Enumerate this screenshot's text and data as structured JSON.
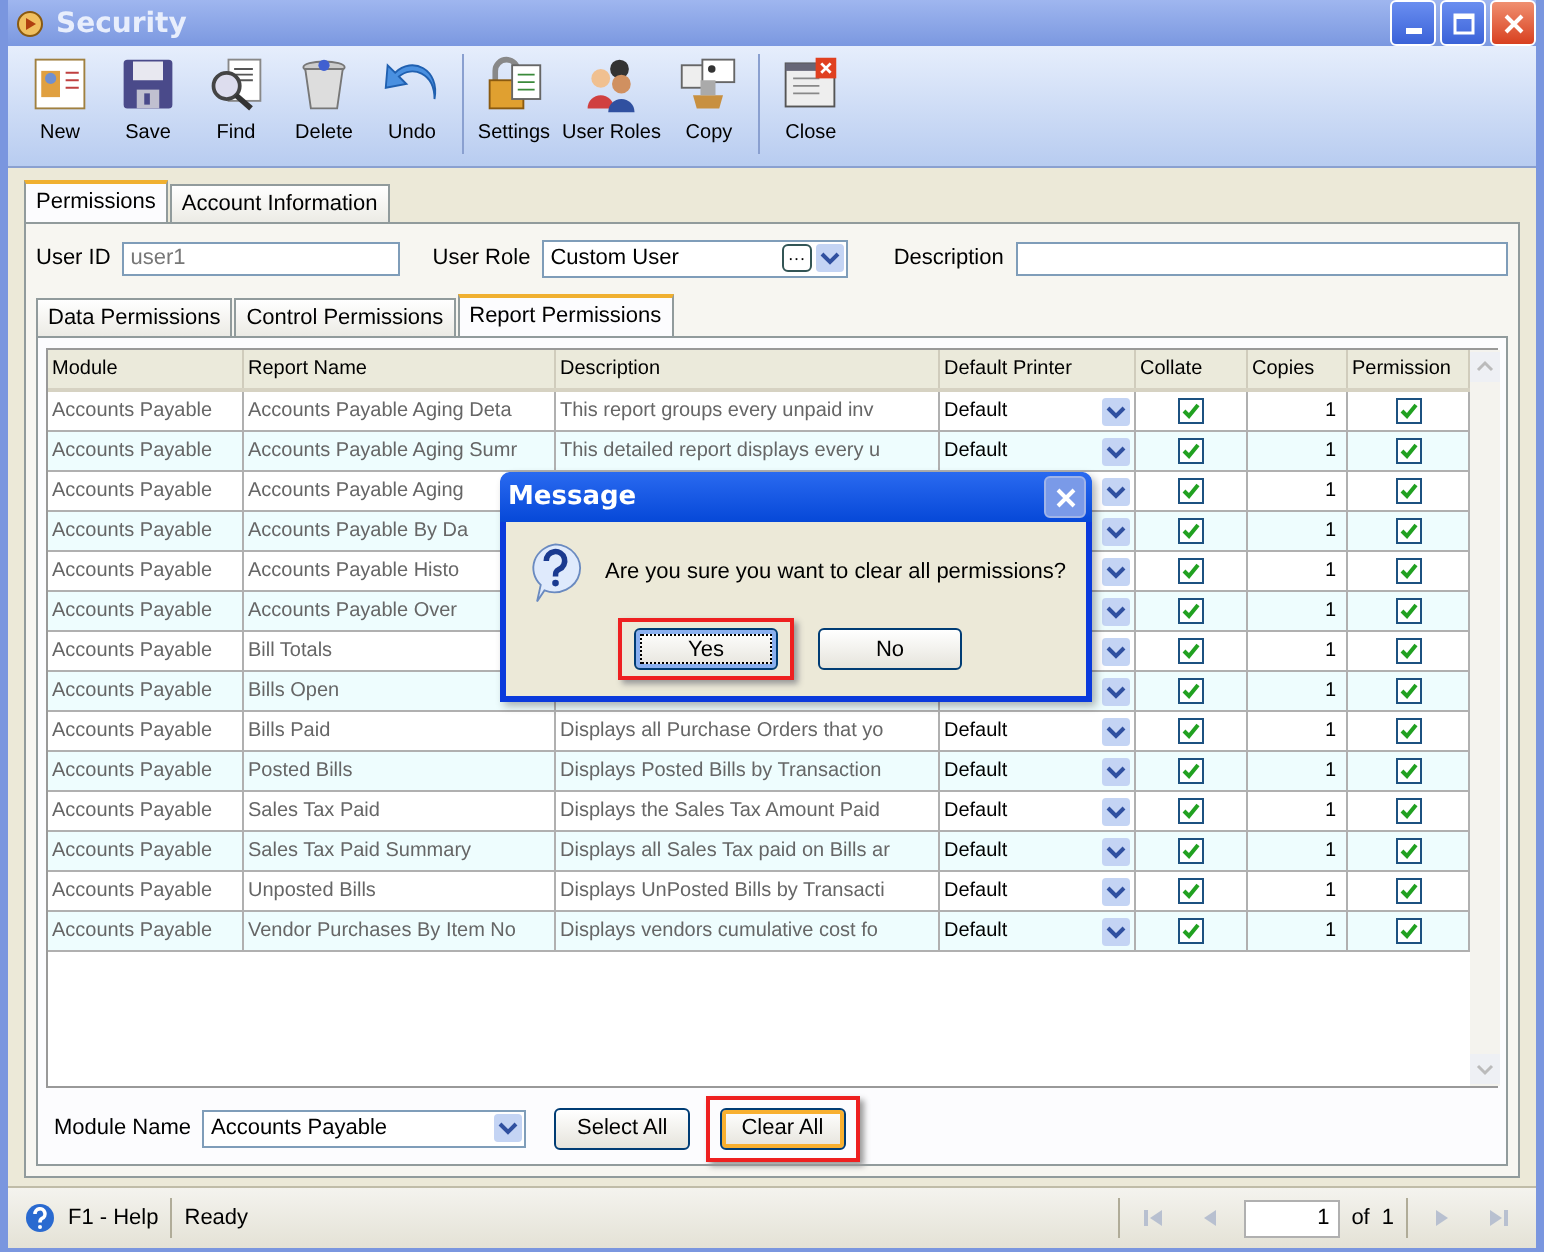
{
  "window": {
    "title": "Security"
  },
  "toolbar": [
    {
      "items": [
        "New",
        "Save",
        "Find",
        "Delete",
        "Undo"
      ]
    },
    {
      "items": [
        "Settings",
        "User Roles",
        "Copy"
      ]
    },
    {
      "items": [
        "Close"
      ]
    }
  ],
  "tabs": [
    {
      "label": "Permissions",
      "selected": true
    },
    {
      "label": "Account Information",
      "selected": false
    }
  ],
  "user_id": {
    "label": "User ID",
    "value": "user1"
  },
  "user_role": {
    "label": "User Role",
    "value": "Custom User",
    "browse": "···"
  },
  "description": {
    "label": "Description"
  },
  "sub_tabs": [
    {
      "label": "Data Permissions",
      "selected": false
    },
    {
      "label": "Control Permissions",
      "selected": false
    },
    {
      "label": "Report Permissions",
      "selected": true
    }
  ],
  "table": {
    "columns": [
      "Module",
      "Report Name",
      "Description",
      "Default Printer",
      "Collate",
      "Copies",
      "Permission"
    ],
    "rows": [
      {
        "module": "Accounts Payable",
        "report_name": "Accounts Payable Aging Deta",
        "description": "This report groups every unpaid inv",
        "printer": "Default",
        "collate": true,
        "copies": "1",
        "permission": true
      },
      {
        "module": "Accounts Payable",
        "report_name": "Accounts Payable Aging Sumr",
        "description": "This detailed report displays every u",
        "printer": "Default",
        "collate": true,
        "copies": "1",
        "permission": true
      },
      {
        "module": "Accounts Payable",
        "report_name": "Accounts Payable Aging",
        "collate": true,
        "copies": "1",
        "permission": true
      },
      {
        "module": "Accounts Payable",
        "report_name": "Accounts Payable By Da",
        "collate": true,
        "copies": "1",
        "permission": true
      },
      {
        "module": "Accounts Payable",
        "report_name": "Accounts Payable Histo",
        "collate": true,
        "copies": "1",
        "permission": true
      },
      {
        "module": "Accounts Payable",
        "report_name": "Accounts Payable Over",
        "collate": true,
        "copies": "1",
        "permission": true
      },
      {
        "module": "Accounts Payable",
        "report_name": "Bill Totals",
        "collate": true,
        "copies": "1",
        "permission": true
      },
      {
        "module": "Accounts Payable",
        "report_name": "Bills Open",
        "collate": true,
        "copies": "1",
        "permission": true
      },
      {
        "module": "Accounts Payable",
        "report_name": "Bills Paid",
        "description": "Displays all Purchase Orders that yo",
        "printer": "Default",
        "collate": true,
        "copies": "1",
        "permission": true
      },
      {
        "module": "Accounts Payable",
        "report_name": "Posted Bills",
        "description": "Displays Posted Bills by Transaction",
        "printer": "Default",
        "collate": true,
        "copies": "1",
        "permission": true
      },
      {
        "module": "Accounts Payable",
        "report_name": "Sales Tax Paid",
        "description": "Displays the Sales Tax Amount Paid",
        "printer": "Default",
        "collate": true,
        "copies": "1",
        "permission": true
      },
      {
        "module": "Accounts Payable",
        "report_name": "Sales Tax Paid Summary",
        "description": "Displays all Sales Tax paid on Bills ar",
        "printer": "Default",
        "collate": true,
        "copies": "1",
        "permission": true
      },
      {
        "module": "Accounts Payable",
        "report_name": "Unposted Bills",
        "description": "Displays UnPosted Bills by Transacti",
        "printer": "Default",
        "collate": true,
        "copies": "1",
        "permission": true
      },
      {
        "module": "Accounts Payable",
        "report_name": "Vendor Purchases By Item No",
        "description": "Displays vendors cumulative cost fo",
        "printer": "Default",
        "collate": true,
        "copies": "1",
        "permission": true
      }
    ]
  },
  "module_name": {
    "label": "Module Name",
    "value": "Accounts Payable"
  },
  "footer_buttons": [
    {
      "label": "Select All",
      "highlighted": false
    },
    {
      "label": "Clear All",
      "highlighted": true
    }
  ],
  "dialog": {
    "title": "Message",
    "message": "Are you sure you want to clear all permissions?",
    "buttons": [
      {
        "label": "Yes",
        "highlighted": true
      },
      {
        "label": "No",
        "highlighted": false
      }
    ]
  },
  "status_bar": {
    "help": "F1 - Help",
    "status": "Ready",
    "page": "1",
    "of": "of",
    "total": "1"
  }
}
